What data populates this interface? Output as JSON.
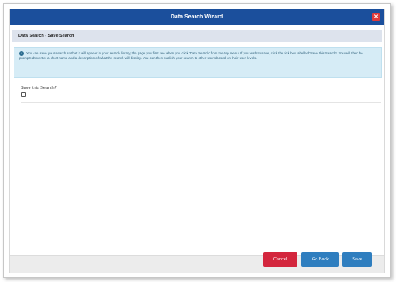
{
  "dialog": {
    "title": "Data Search Wizard",
    "close_symbol": "✕",
    "section_title": "Data Search - Save Search",
    "info_icon": "i",
    "info_text": "You can save your search so that it will appear in your search library, the page you first see when you click 'Data Search' from the top menu. If you wish to save, click the tick box labelled 'Save this Search'. You will then be prompted to enter a short name and a description of what the search will display. You can then publish your search to other users based on their user levels.",
    "save_label": "Save this Search?",
    "save_checked": false
  },
  "footer": {
    "cancel_label": "Cancel",
    "back_label": "Go Back",
    "save_label": "Save"
  },
  "colors": {
    "titlebar": "#1b4f9c",
    "cancel": "#d3263d",
    "primary": "#2f7ebf",
    "info_bg": "#d6ecf6"
  }
}
